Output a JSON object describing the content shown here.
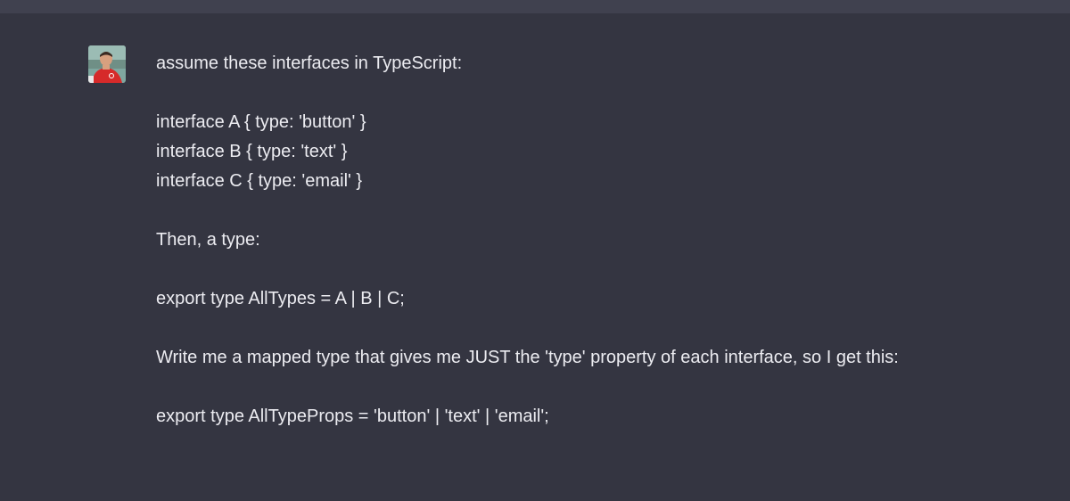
{
  "conversation": {
    "user_message": {
      "avatar_icon": "user-avatar-photo",
      "lines": [
        "assume these interfaces in TypeScript:",
        "interface A { type: 'button' }",
        "interface B { type: 'text' }",
        "interface C { type: 'email' }",
        "Then, a type:",
        "export type AllTypes = A | B | C;",
        "Write me a mapped type that gives me JUST the 'type' property of each interface, so I get this:",
        "export type AllTypeProps = 'button' | 'text' | 'email';"
      ]
    }
  },
  "colors": {
    "background": "#343541",
    "top_strip": "#40414f",
    "text": "#ececf1"
  }
}
